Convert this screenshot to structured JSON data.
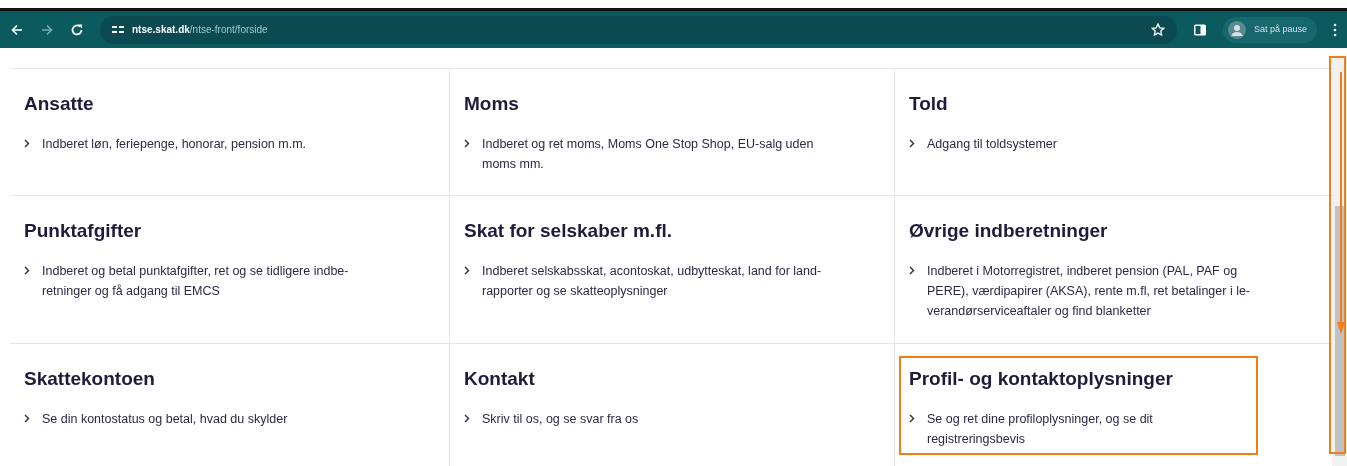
{
  "browser": {
    "url_host": "ntse.skat.dk",
    "url_path": "/ntse-front/forside",
    "profile_label": "Sat på pause"
  },
  "tiles": [
    {
      "title": "Ansatte",
      "link": "Indberet løn, feriepenge, honorar, pension m.m.",
      "highlighted": false
    },
    {
      "title": "Moms",
      "link": "Indberet og ret moms, Moms One Stop Shop, EU-salg uden moms mm.",
      "highlighted": false
    },
    {
      "title": "Told",
      "link": "Adgang til toldsystemer",
      "highlighted": false
    },
    {
      "title": "Punktafgifter",
      "link": "Indberet og betal punktafgifter, ret og se tidligere indbe-retninger og få adgang til EMCS",
      "highlighted": false
    },
    {
      "title": "Skat for selskaber m.fl.",
      "link": "Indberet selskabsskat, acontoskat, udbytteskat, land for land-rapporter og se skatteoplysninger",
      "highlighted": false
    },
    {
      "title": "Øvrige indberetninger",
      "link": "Indberet i Motorregistret, indberet pension (PAL, PAF og PERE), værdipapirer (AKSA), rente m.fl, ret betalinger i le-verandørserviceaftaler og find blanketter",
      "highlighted": false
    },
    {
      "title": "Skattekontoen",
      "link": "Se din kontostatus og betal, hvad du skylder",
      "highlighted": false
    },
    {
      "title": "Kontakt",
      "link": "Skriv til os, og se svar fra os",
      "highlighted": false
    },
    {
      "title": "Profil- og kontaktoplysninger",
      "link": "Se og ret dine profiloplysninger, og se dit registreringsbevis",
      "highlighted": true
    }
  ],
  "scrollbar": {
    "highlighted": true
  }
}
